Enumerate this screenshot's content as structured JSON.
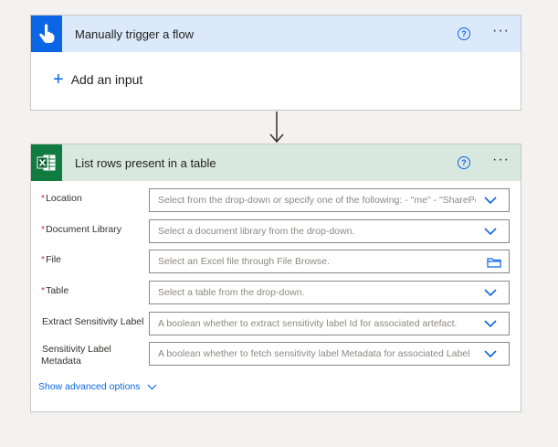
{
  "trigger": {
    "title": "Manually trigger a flow",
    "help_label": "?",
    "more_label": "···",
    "add_input_label": "Add an input",
    "plus_label": "+"
  },
  "action": {
    "title": "List rows present in a table",
    "help_label": "?",
    "more_label": "···",
    "fields": [
      {
        "label": "Location",
        "required": "*",
        "placeholder": "Select from the drop-down or specify one of the following: - \"me\" - \"SharePoint Site URL\"",
        "control": "chevron-down-icon"
      },
      {
        "label": "Document Library",
        "required": "*",
        "placeholder": "Select a document library from the drop-down.",
        "control": "chevron-down-icon"
      },
      {
        "label": "File",
        "required": "*",
        "placeholder": "Select an Excel file through File Browse.",
        "control": "folder-icon"
      },
      {
        "label": "Table",
        "required": "*",
        "placeholder": "Select a table from the drop-down.",
        "control": "chevron-down-icon"
      },
      {
        "label": "Extract Sensitivity Label",
        "required": "",
        "placeholder": "A boolean whether to extract sensitivity label Id for associated artefact.",
        "control": "chevron-down-icon"
      },
      {
        "label": "Sensitivity Label Metadata",
        "required": "",
        "placeholder": "A boolean whether to fetch sensitivity label Metadata for associated Label",
        "control": "chevron-down-icon"
      }
    ],
    "advanced_label": "Show advanced options"
  },
  "colors": {
    "trigger_accent": "#0a66e4",
    "trigger_header": "#dbe9fb",
    "excel_accent": "#107c41",
    "action_header": "#d9e8df",
    "required": "#d13438",
    "link": "#0a66e4"
  },
  "icons": [
    "hand-pointer-icon",
    "excel-icon",
    "help-icon",
    "more-icon",
    "plus-icon",
    "arrow-down-icon",
    "chevron-down-icon",
    "folder-icon"
  ]
}
